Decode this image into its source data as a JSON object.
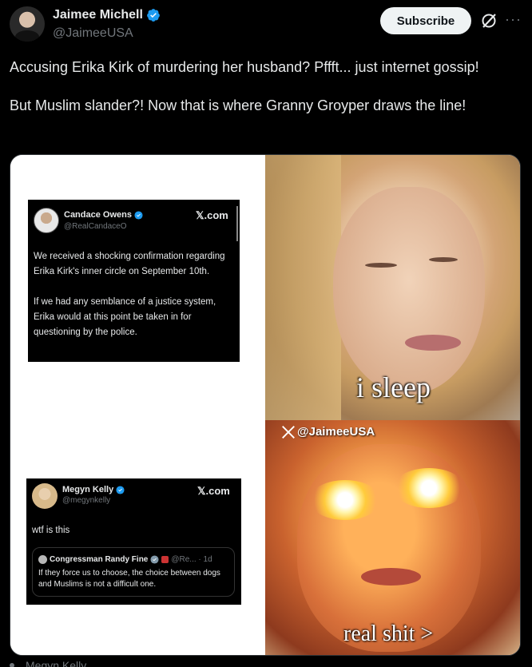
{
  "author": {
    "name": "Jaimee Michell",
    "handle": "@JaimeeUSA"
  },
  "actions": {
    "subscribe_label": "Subscribe",
    "more_glyph": "···"
  },
  "tweet": {
    "text": "Accusing Erika Kirk of murdering her husband? Pffft... just internet gossip!\n\nBut Muslim slander?! Now that is where Granny Groyper draws the line!"
  },
  "meme": {
    "card1": {
      "name": "Candace Owens",
      "handle": "@RealCandaceO",
      "site": "𝕏.com",
      "body": "We received a shocking confirmation regarding Erika Kirk's inner circle on September 10th.\n\nIf we had any semblance of a justice system, Erika would at this point be taken in for questioning by the police."
    },
    "card2": {
      "name": "Megyn Kelly",
      "handle": "@megynkelly",
      "site": "𝕏.com",
      "body": "wtf is this",
      "quote": {
        "name": "Congressman Randy Fine",
        "meta": "@Re... · 1d",
        "body": "If they force us to choose, the choice between dogs and Muslims is not a difficult one."
      }
    },
    "caption_top": "i sleep",
    "caption_bottom": "real shit >",
    "watermark": "@JaimeeUSA"
  },
  "footer": {
    "next_author": "Megyn Kelly"
  },
  "colors": {
    "accent": "#1d9bf0",
    "background": "#000000",
    "secondary_text": "#71767b"
  }
}
